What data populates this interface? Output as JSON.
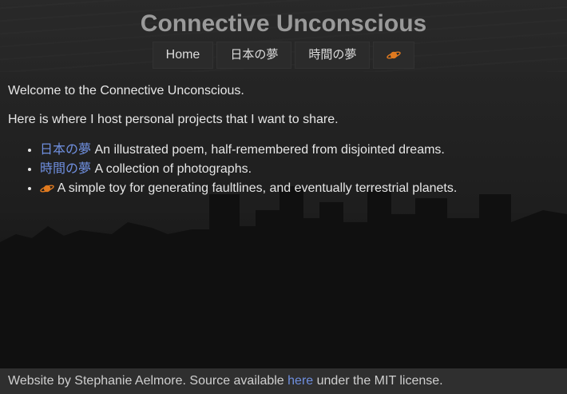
{
  "site": {
    "title": "Connective Unconscious"
  },
  "nav": [
    {
      "label": "Home"
    },
    {
      "label": "日本の夢"
    },
    {
      "label": "時間の夢"
    },
    {
      "label": "",
      "icon": "planet-icon"
    }
  ],
  "main": {
    "intro": "Welcome to the Connective Unconscious.",
    "subintro": "Here is where I host personal projects that I want to share.",
    "projects": [
      {
        "link": "日本の夢",
        "desc": " An illustrated poem, half-remembered from disjointed dreams."
      },
      {
        "link": "時間の夢",
        "desc": " A collection of photographs."
      },
      {
        "link": "",
        "icon": "planet-icon",
        "desc": " A simple toy for generating faultlines, and eventually terrestrial planets."
      }
    ]
  },
  "footer": {
    "prefix": "Website by Stephanie Aelmore. Source available ",
    "link": "here",
    "suffix": " under the MIT license."
  },
  "colors": {
    "link": "#6f8fdf",
    "planet": "#e07a1f"
  }
}
